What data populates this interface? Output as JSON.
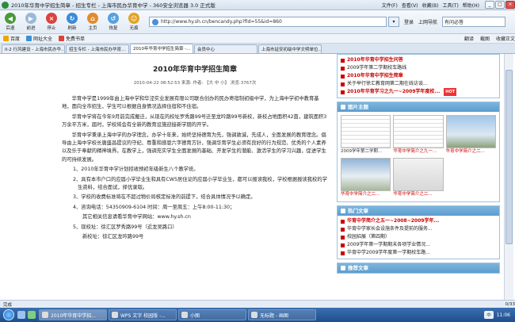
{
  "window": {
    "title": "2010年华育中学招生简章 - 招生专栏 - 上海市民办华育中学 - 360安全浏览器 3.0 正式版",
    "menus": [
      "文件(F)",
      "查看(V)",
      "收藏(B)",
      "工具(T)",
      "帮助(H)"
    ]
  },
  "toolbar": {
    "back": "后退",
    "forward": "前进",
    "stop": "停止",
    "refresh": "刷新",
    "home": "主页",
    "restore": "恢复",
    "no_trace": "无痕",
    "address": "http://www.hy.sh.cn/bencandy.php?fid=55&id=860",
    "go": "▾",
    "tools": [
      "登录",
      "上网导航",
      "有问必答"
    ]
  },
  "favbar": {
    "items": [
      "百度",
      "网址大全",
      "免费书单"
    ],
    "right_items": [
      "翻译",
      "截图",
      "收藏正文"
    ]
  },
  "tabs": [
    {
      "label": "II-2 行风建设 - 上海市民办华...",
      "active": false
    },
    {
      "label": "招生专栏 - 上海市民办华育...",
      "active": false
    },
    {
      "label": "2010年华育中学招生简章 -...",
      "active": true
    },
    {
      "label": "会员中心",
      "active": false
    },
    {
      "label": "上海市延安初级中学文明单位...",
      "active": false
    }
  ],
  "article": {
    "title": "2010年华育中学招生简章",
    "meta": "2010-04-22 08:52:53 来源: 作者: 【大 中 小】 浏览:3767次",
    "paragraphs": [
      "华育中学是1999年由上海中学和华泾实业发展有限公司联合创办的民办寄宿制初级中学，为上海中学初中教育基地，面向全市招生，学生可以根据自身情况选择住宿和不住宿。",
      "华育中学将在今年9月前完成搬迁，从现在的校址罗秀路99号迁至龙吟路99号新校，新校占地面积42亩，建筑面积3万余平方米，届时，学校将会有全新的教育设施迎接新学期的开学。",
      "华育中学秉承上海中学的办学理念，办学十年来，始终坚持德育为先，强调敦诚，先成人，全面发展的教育理念。倡导由上海中学校长唐盛昌提议的守纪、尊重和感恩六字德育方针，强调华育学生必须有良好的行为规范、优秀的个人素养以及乐于奉献的精神境界。在教学上，强调充实学生全面发展的基础、开发学生的潜能、激活学生的学习兴趣，促进学生的可持续发展。"
    ],
    "items": [
      "1、2010年华育中学计划招收预初年级新生八个教学班。",
      "2、具有本市户口的应届小学毕业生和具有CW5居住证的应届小学毕业生，都可以报读我校，学校根据报读我校的学生资料，结合面试，择优录取。",
      "3、学校的收费标准将在不超过物价局核定标准的前提下，结合具体情况予以确定。",
      "4、咨询电话：54350909-6104 时间：周一至周五：上午8:00-11:30；"
    ],
    "website_line": "其它相关信息请看华育中学网站：www.hy.sh.cn",
    "item5": "5、现校址：徐汇区罗秀路99号（近龙吴路口）",
    "new_address": "新校址：徐汇区龙吟路99号"
  },
  "sidebar": {
    "notice_list": [
      {
        "text": "2010年华育中学招生问答",
        "red": true,
        "hot": ""
      },
      {
        "text": "2009学年第二学期校车路线",
        "red": false,
        "hot": ""
      },
      {
        "text": "2010年华育中学招生简章",
        "red": true,
        "hot": ""
      },
      {
        "text": "关于举行徐汇教育网第二期在线访谈...",
        "red": false,
        "hot": ""
      },
      {
        "text": "2010年华育学习之九一~2009学年度校...",
        "red": true,
        "hot": "HOT"
      }
    ],
    "gallery_title": "图片主题",
    "gallery": [
      {
        "caption": "2009学年第二学期...",
        "kind": "doc",
        "red": false
      },
      {
        "caption": "华育中学简介之九一...",
        "kind": "doc",
        "red": true
      },
      {
        "caption": "华育中学简介之二...",
        "kind": "photo1",
        "red": true
      },
      {
        "caption": "华育中学简介之二...",
        "kind": "photo3",
        "red": true
      },
      {
        "caption": "华育中学简介之二...",
        "kind": "photo2",
        "red": true
      }
    ],
    "hot_title": "热门文章",
    "hot_list": [
      {
        "text": "华育中学简介之五一~2008~2009学年...",
        "red": true,
        "hot": ""
      },
      {
        "text": "华育中学家长会设施条件及提前的服务...",
        "red": false,
        "hot": ""
      },
      {
        "text": "校园招展（第四期）",
        "red": false,
        "hot": ""
      },
      {
        "text": "2009学年第一学期期末各项学业情况...",
        "red": false,
        "hot": ""
      },
      {
        "text": "华育中学2009学年度第一学期校车路...",
        "red": false,
        "hot": ""
      }
    ],
    "recommend_title": "推荐文章"
  },
  "status": {
    "left": "完成",
    "zoom": "0/33",
    "ime": "中"
  },
  "taskbar": {
    "tasks": [
      {
        "label": "2010年华育中学招...",
        "active": true
      },
      {
        "label": "WPS 文字 校园版 -...",
        "active": false
      },
      {
        "label": "小图",
        "active": false
      },
      {
        "label": "无标题 - 画图",
        "active": false
      }
    ],
    "clock": "11:06"
  }
}
